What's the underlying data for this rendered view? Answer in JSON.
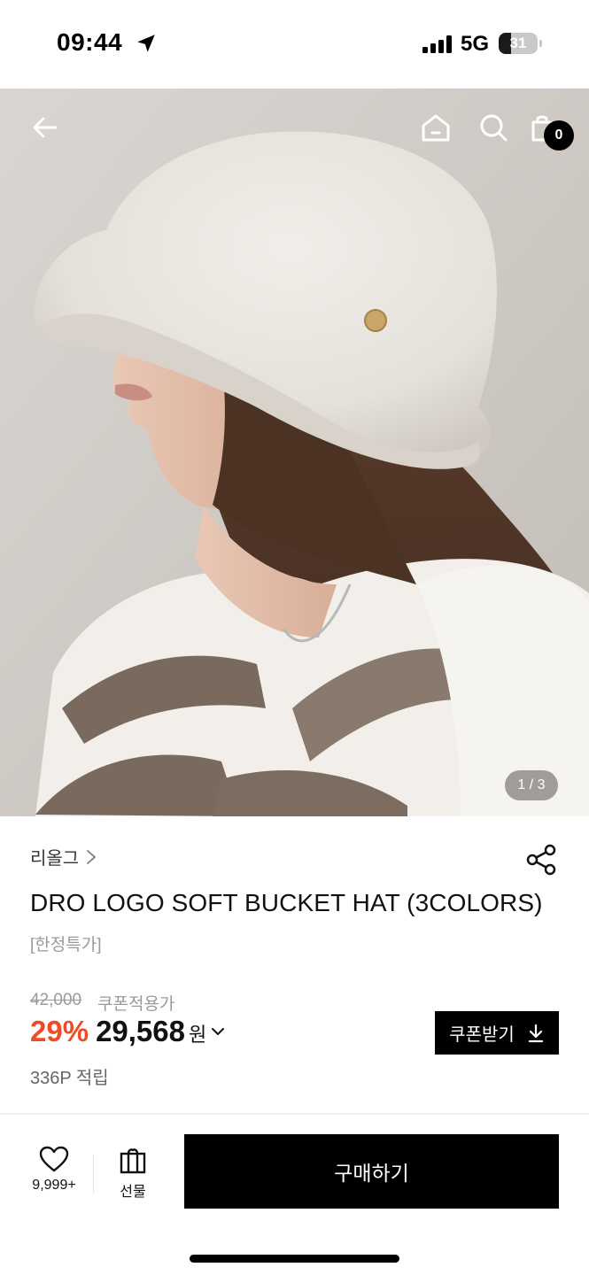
{
  "status_bar": {
    "time": "09:44",
    "network": "5G",
    "battery": "31",
    "battery_level_percent": 31
  },
  "hero": {
    "page_indicator": "1 / 3",
    "cart_count": "0",
    "icons": [
      "back-arrow-icon",
      "home-icon",
      "search-icon",
      "shopping-bag-icon"
    ]
  },
  "product": {
    "brand": "리올그",
    "title": "DRO LOGO SOFT BUCKET HAT (3COLORS)",
    "tag": "[한정특가]",
    "original_price": "42,000",
    "coupon_price_label": "쿠폰적용가",
    "discount": "29%",
    "price": "29,568",
    "currency": "원",
    "points": "336P 적립",
    "coupon_button": "쿠폰받기"
  },
  "bottom_bar": {
    "like_count": "9,999+",
    "gift_label": "선물",
    "buy_label": "구매하기"
  },
  "colors": {
    "accent_discount": "#ef4b24",
    "button_bg": "#000000"
  }
}
